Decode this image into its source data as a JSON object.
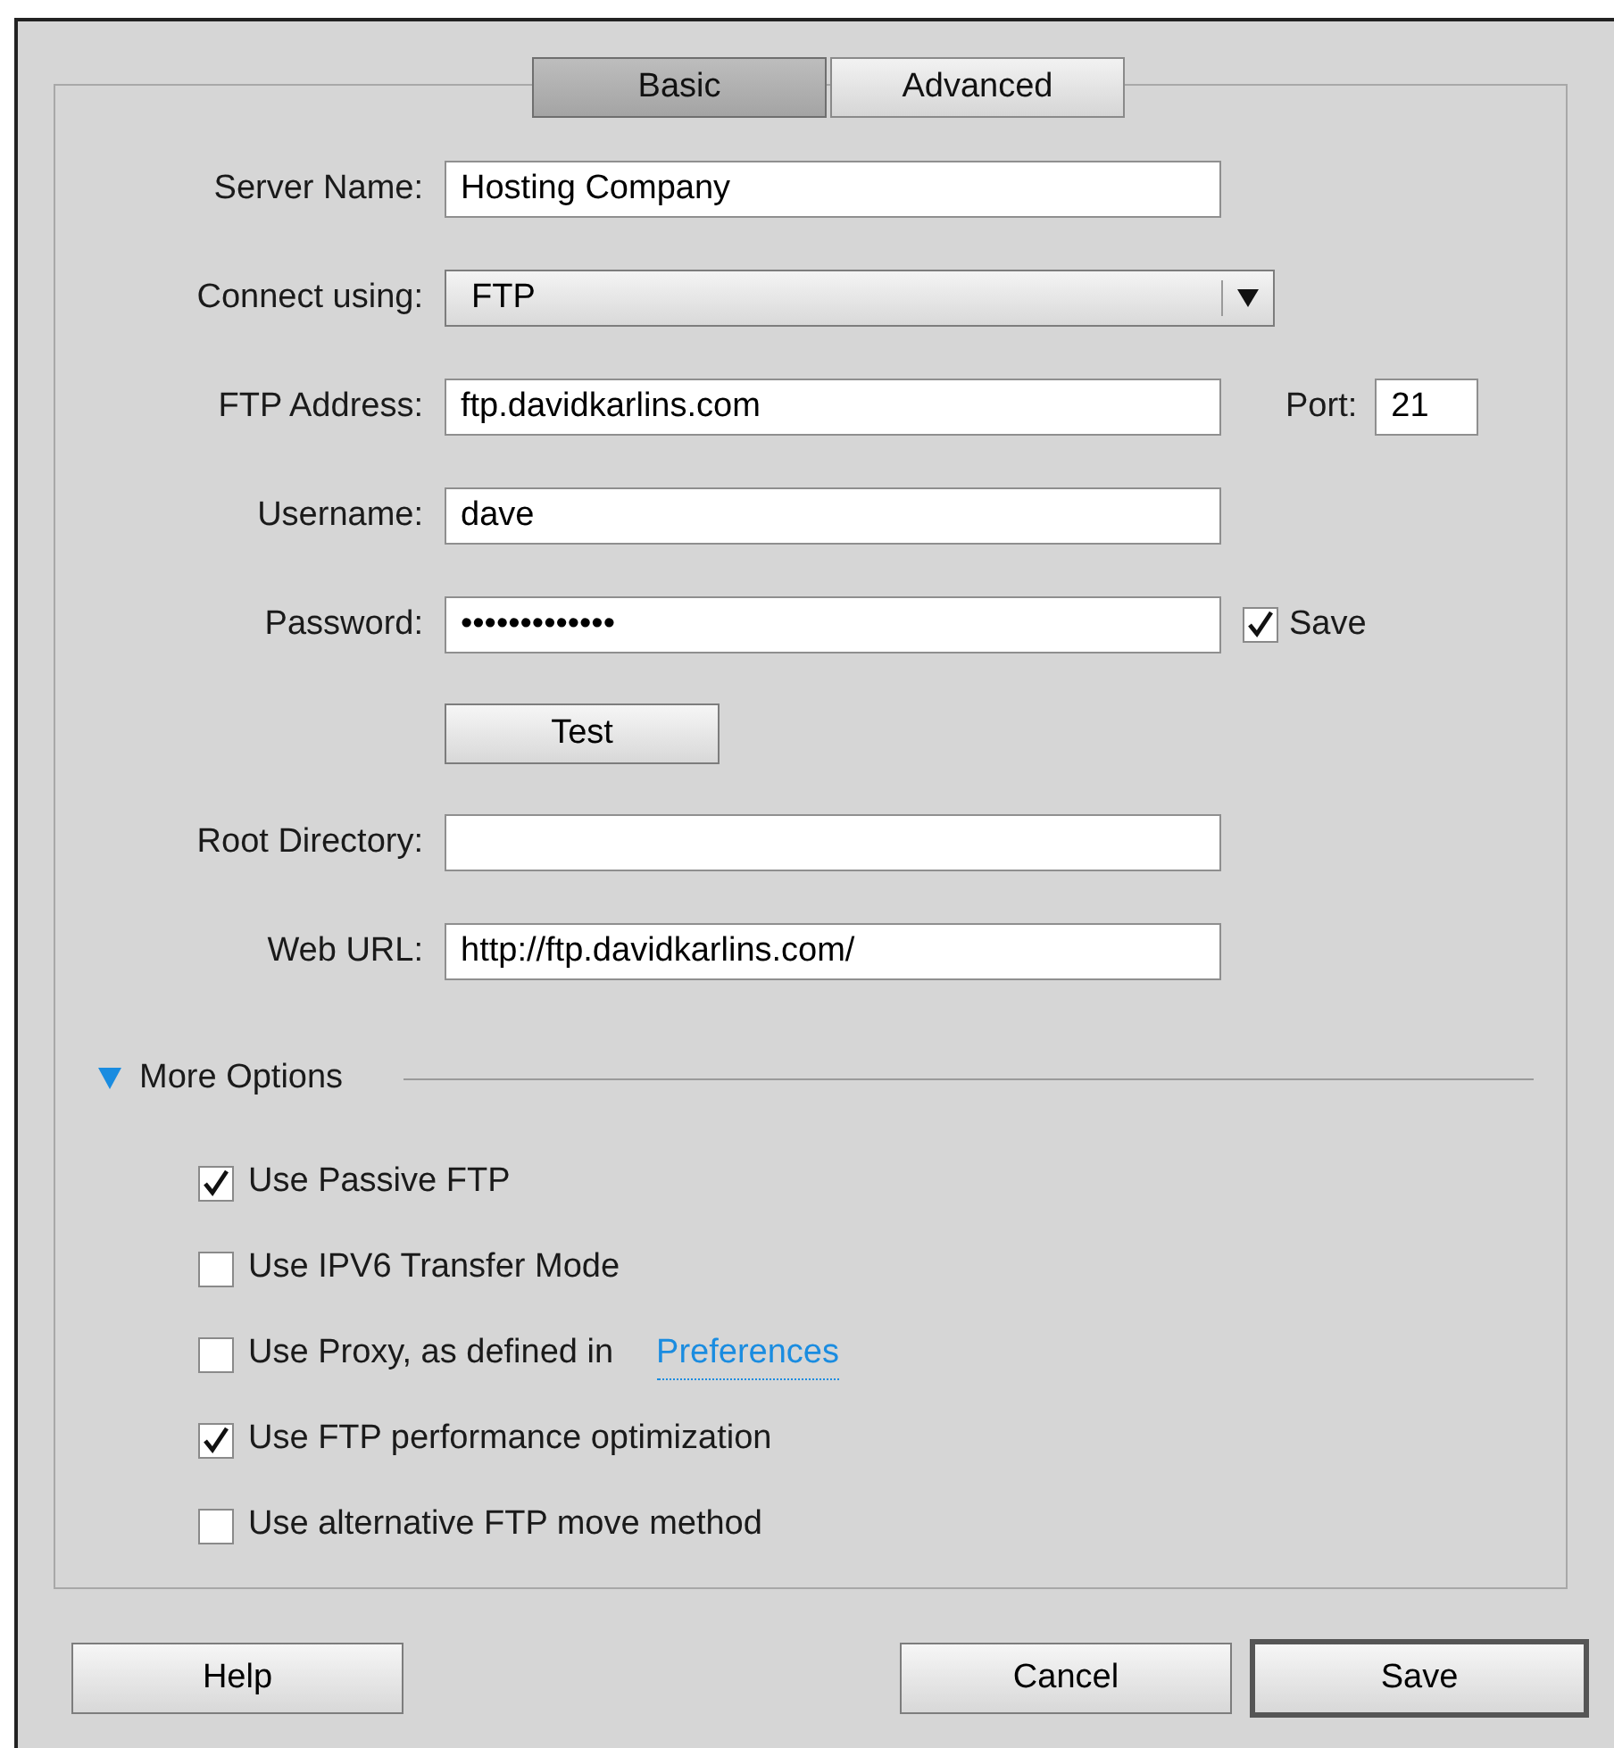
{
  "tabs": [
    {
      "label": "Basic",
      "selected": true
    },
    {
      "label": "Advanced",
      "selected": false
    }
  ],
  "fields": [
    {
      "kind": "text",
      "label": "Server Name:",
      "value": "Hosting Company"
    },
    {
      "kind": "select",
      "label": "Connect using:",
      "value": "FTP"
    },
    {
      "kind": "text",
      "label": "FTP Address:",
      "value": "ftp.davidkarlins.com",
      "extra": {
        "label": "Port:",
        "value": "21"
      }
    },
    {
      "kind": "text",
      "label": "Username:",
      "value": "dave"
    },
    {
      "kind": "password",
      "label": "Password:",
      "value": "•••••••••••••",
      "save": {
        "label": "Save",
        "checked": true
      }
    },
    {
      "kind": "button",
      "label": "Test"
    },
    {
      "kind": "text",
      "label": "Root Directory:"
    },
    {
      "kind": "text",
      "label": "Web URL:",
      "value": "http://ftp.davidkarlins.com/"
    }
  ],
  "more_options": {
    "label": "More Options",
    "expanded": true,
    "options": [
      {
        "label": "Use Passive FTP",
        "checked": true
      },
      {
        "label": "Use IPV6 Transfer Mode",
        "checked": false
      },
      {
        "label": "Use Proxy, as defined in",
        "link": "Preferences",
        "checked": false
      },
      {
        "label": "Use FTP performance optimization",
        "checked": true
      },
      {
        "label": "Use alternative FTP move method",
        "checked": false
      }
    ]
  },
  "buttons": [
    {
      "label": "Help",
      "kind": "normal"
    },
    {
      "label": "Cancel",
      "kind": "normal"
    },
    {
      "label": "Save",
      "kind": "default"
    }
  ]
}
